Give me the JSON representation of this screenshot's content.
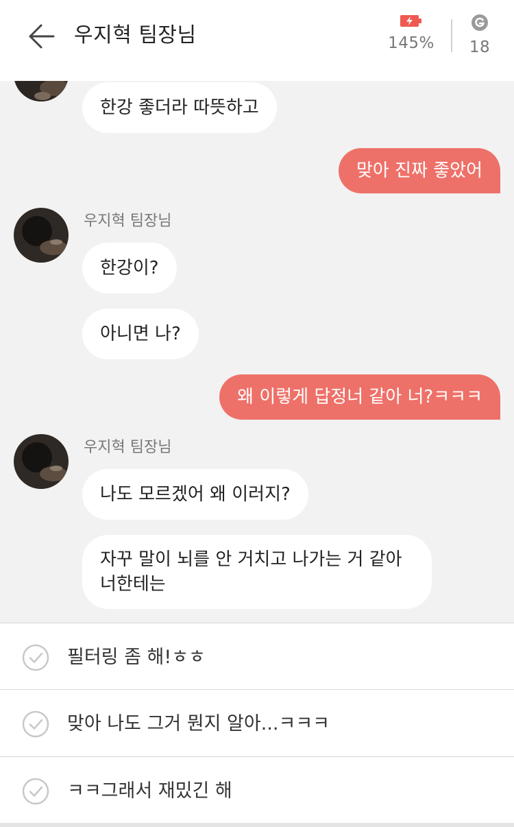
{
  "header": {
    "title": "우지혁 팀장님",
    "battery_value": "145%",
    "g_value": "18"
  },
  "colors": {
    "accent": "#ee7169",
    "background": "#f2f2f2"
  },
  "icons": [
    "back-arrow-icon",
    "battery-charging-icon",
    "g-coin-icon",
    "checkmark-circle-icon"
  ],
  "chat": {
    "sender_name": "우지혁 팀장님",
    "messages": [
      {
        "from": "them",
        "text": "한강 좋더라 따뜻하고"
      },
      {
        "from": "me",
        "text": "맞아 진짜 좋았어"
      },
      {
        "from": "them",
        "text": "한강이?"
      },
      {
        "from": "them",
        "text": "아니면 나?"
      },
      {
        "from": "me",
        "text": "왜 이렇게 답정너 같아 너?ㅋㅋㅋ"
      },
      {
        "from": "them",
        "text": "나도 모르겠어 왜 이러지?"
      },
      {
        "from": "them",
        "line1": "자꾸 말이 뇌를 안 거치고 나가는 거 같아",
        "line2": "너한테는"
      }
    ]
  },
  "suggestions": [
    {
      "text": "필터링 좀 해!ㅎㅎ"
    },
    {
      "text": "맞아 나도 그거 뭔지 알아...ㅋㅋㅋ"
    },
    {
      "text": "ㅋㅋ그래서 재밌긴 해"
    }
  ]
}
